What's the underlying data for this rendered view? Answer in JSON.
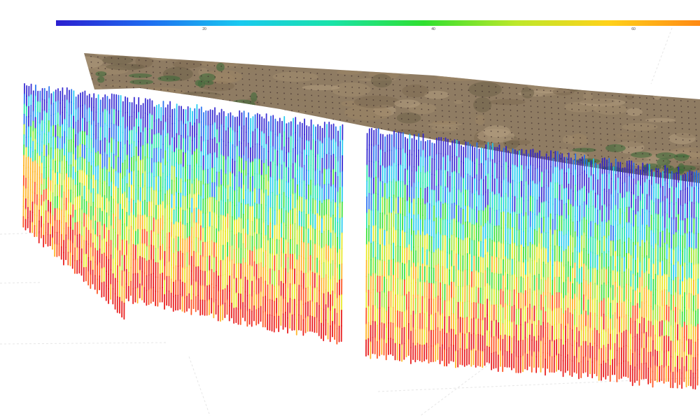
{
  "colorbar": {
    "tick_labels": [
      "20",
      "40",
      "60"
    ],
    "colors": [
      "#2b1fd0",
      "#1e6cf0",
      "#19c9f0",
      "#19e3a8",
      "#2fe02f",
      "#bde82a",
      "#ffd21a",
      "#ff8a14"
    ]
  },
  "scene": {
    "terrain_colors": [
      "#8f7c63",
      "#a38d70",
      "#7d6a52",
      "#b39d80",
      "#6e6048",
      "#9c8566"
    ],
    "vegetation_color": "#3f6b3a",
    "grid_line_color": "#e6e6e6",
    "column_palette": [
      "#2b1fd0",
      "#1e6cf0",
      "#19c9f0",
      "#19e3a8",
      "#2fe02f",
      "#9fe82a",
      "#e8e81a",
      "#ffb01a",
      "#ff4a14",
      "#e80f0f"
    ]
  }
}
